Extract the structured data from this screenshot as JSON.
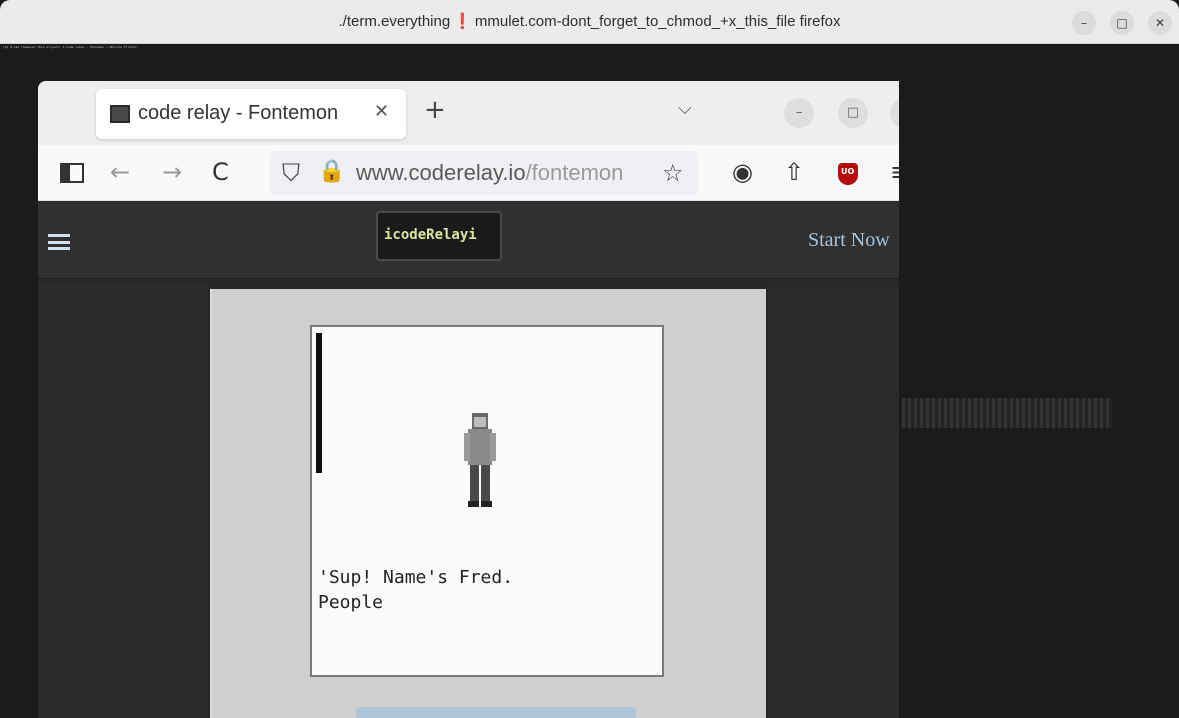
{
  "window": {
    "title_prefix": "./term.everything",
    "title_bang": "❗",
    "title_suffix": "mmulet.com-dont_forget_to_chmod_+x_this_file firefox",
    "minimize_glyph": "–",
    "maximize_glyph": "□",
    "close_glyph": "✕"
  },
  "terminal": {
    "status_line": "[0] 0:ssh [Spawner this project] 1:code relay - Fontemon — Mozilla Firefox"
  },
  "browser": {
    "tab": {
      "title": "code relay - Fontemon",
      "close_glyph": "✕"
    },
    "new_tab_glyph": "+",
    "tab_list_glyph": "⌵",
    "window_controls": {
      "minimize": "–",
      "maximize": "□",
      "close": "✕"
    },
    "nav": {
      "back_glyph": "←",
      "forward_glyph": "→",
      "reload_glyph": "C"
    },
    "url": {
      "host": "www.coderelay.io",
      "path": "/fontemon"
    },
    "toolbar_glyphs": {
      "shield": "⛉",
      "lock": "🔒",
      "star": "☆",
      "account": "◉",
      "extensions": "⇧",
      "menu": "≡",
      "ublock": "UO"
    }
  },
  "site": {
    "logo_text": "icodeRelayi",
    "start_link": "Start Now"
  },
  "game": {
    "dialog": "'Sup! Name's Fred.\nPeople"
  },
  "colors": {
    "window_chrome": "#ebebeb",
    "terminal_bg": "#1b1b19",
    "site_header": "#303030",
    "link": "#aac4da",
    "alert": "#d21e1e",
    "ublock": "#b50c0c"
  }
}
